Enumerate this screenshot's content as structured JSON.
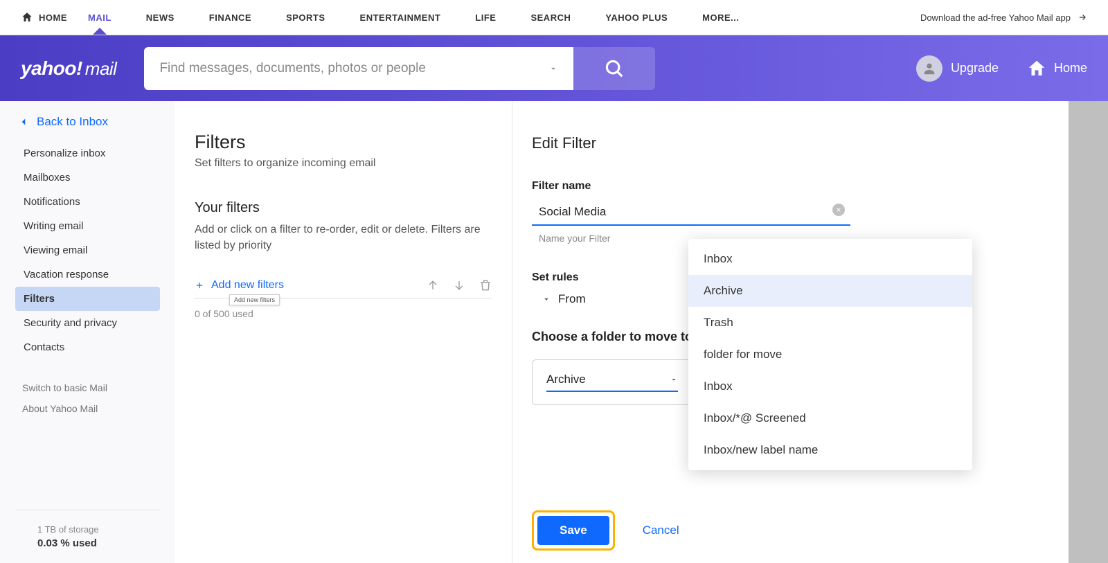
{
  "topnav": {
    "home": "HOME",
    "items": [
      "MAIL",
      "NEWS",
      "FINANCE",
      "SPORTS",
      "ENTERTAINMENT",
      "LIFE",
      "SEARCH",
      "YAHOO PLUS",
      "MORE..."
    ],
    "download": "Download the ad-free Yahoo Mail app"
  },
  "logo": {
    "brand": "yahoo!",
    "product": "mail"
  },
  "search": {
    "placeholder": "Find messages, documents, photos or people"
  },
  "header": {
    "upgrade": "Upgrade",
    "home": "Home"
  },
  "sidebar": {
    "back": "Back to Inbox",
    "items": [
      "Personalize inbox",
      "Mailboxes",
      "Notifications",
      "Writing email",
      "Viewing email",
      "Vacation response",
      "Filters",
      "Security and privacy",
      "Contacts"
    ],
    "activeIndex": 6,
    "bottom": [
      "Switch to basic Mail",
      "About Yahoo Mail"
    ],
    "storage_line": "1 TB of storage",
    "storage_used": "0.03 % used"
  },
  "filters": {
    "title": "Filters",
    "subtitle": "Set filters to organize incoming email",
    "your_filters": "Your filters",
    "desc": "Add or click on a filter to re-order, edit or delete. Filters are listed by priority",
    "add_label": "Add new filters",
    "tooltip": "Add new filters",
    "used": "0 of 500 used"
  },
  "edit": {
    "title": "Edit Filter",
    "name_label": "Filter name",
    "name_value": "Social Media",
    "helper": "Name your Filter",
    "rules_label": "Set rules",
    "from": "From",
    "choose": "Choose a folder to move to",
    "selected": "Archive",
    "save": "Save",
    "cancel": "Cancel"
  },
  "menu": {
    "options": [
      "Inbox",
      "Archive",
      "Trash",
      "folder for move",
      "Inbox",
      "Inbox/*@ Screened",
      "Inbox/new label name"
    ],
    "highlightIndex": 1
  }
}
